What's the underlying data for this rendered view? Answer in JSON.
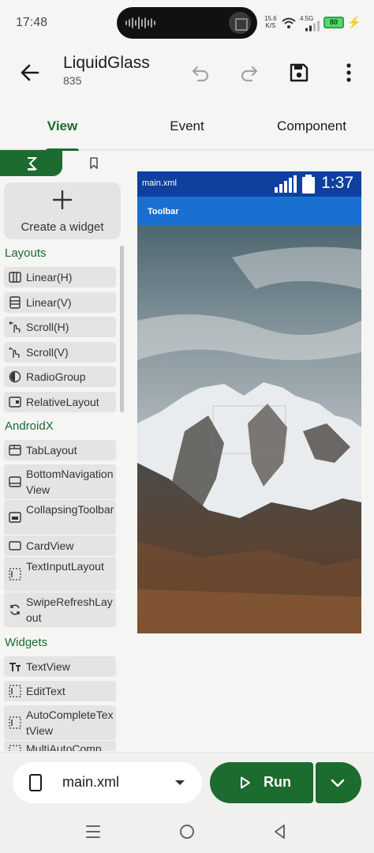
{
  "status_bar": {
    "time": "17:48",
    "net_speed": "15.6",
    "net_unit": "K/S",
    "net_type": "4.5G",
    "battery": "80"
  },
  "appbar": {
    "title": "LiquidGlass",
    "subtitle": "835"
  },
  "tabs": [
    {
      "label": "View",
      "active": true
    },
    {
      "label": "Event",
      "active": false
    },
    {
      "label": "Component",
      "active": false
    }
  ],
  "palette": {
    "create_label": "Create a widget",
    "sections": {
      "layouts": "Layouts",
      "androidx": "AndroidX",
      "widgets": "Widgets"
    },
    "layouts": [
      "Linear(H)",
      "Linear(V)",
      "Scroll(H)",
      "Scroll(V)",
      "RadioGroup",
      "RelativeLayout"
    ],
    "androidx": [
      "TabLayout",
      "BottomNavigationView",
      "CollapsingToolbar",
      "CardView",
      "TextInputLayout",
      "SwipeRefreshLayout"
    ],
    "widgets": [
      "TextView",
      "EditText",
      "AutoCompleteTextView",
      "MultiAutoComp"
    ]
  },
  "preview": {
    "file_label": "main.xml",
    "clock": "1:37",
    "toolbar_title": "Toolbar"
  },
  "bottom": {
    "file": "main.xml",
    "run_label": "Run"
  },
  "colors": {
    "accent": "#1c6b2f",
    "preview_statusbar": "#0f40a0",
    "preview_toolbar": "#1a70d0"
  }
}
